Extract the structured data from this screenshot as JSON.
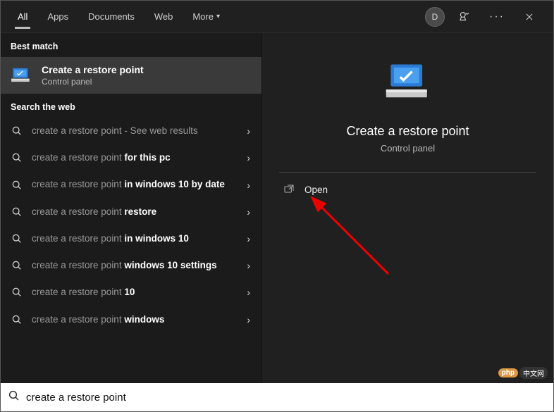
{
  "header": {
    "tabs": [
      "All",
      "Apps",
      "Documents",
      "Web",
      "More"
    ],
    "active_tab": 0,
    "avatar_initial": "D"
  },
  "left": {
    "best_label": "Best match",
    "best": {
      "title": "Create a restore point",
      "subtitle": "Control panel"
    },
    "web_label": "Search the web",
    "web_items": [
      {
        "prefix": "create a restore point",
        "suffix": "",
        "hint": " - See web results"
      },
      {
        "prefix": "create a restore point ",
        "suffix": "for this pc",
        "hint": ""
      },
      {
        "prefix": "create a restore point ",
        "suffix": "in windows 10 by date",
        "hint": ""
      },
      {
        "prefix": "create a restore point ",
        "suffix": "restore",
        "hint": ""
      },
      {
        "prefix": "create a restore point ",
        "suffix": "in windows 10",
        "hint": ""
      },
      {
        "prefix": "create a restore point ",
        "suffix": "windows 10 settings",
        "hint": ""
      },
      {
        "prefix": "create a restore point ",
        "suffix": "10",
        "hint": ""
      },
      {
        "prefix": "create a restore point ",
        "suffix": "windows",
        "hint": ""
      }
    ]
  },
  "right": {
    "title": "Create a restore point",
    "subtitle": "Control panel",
    "open_label": "Open"
  },
  "search": {
    "value": "create a restore point",
    "placeholder": "Type here to search"
  },
  "watermark": {
    "a": "php",
    "b": "中文网"
  }
}
